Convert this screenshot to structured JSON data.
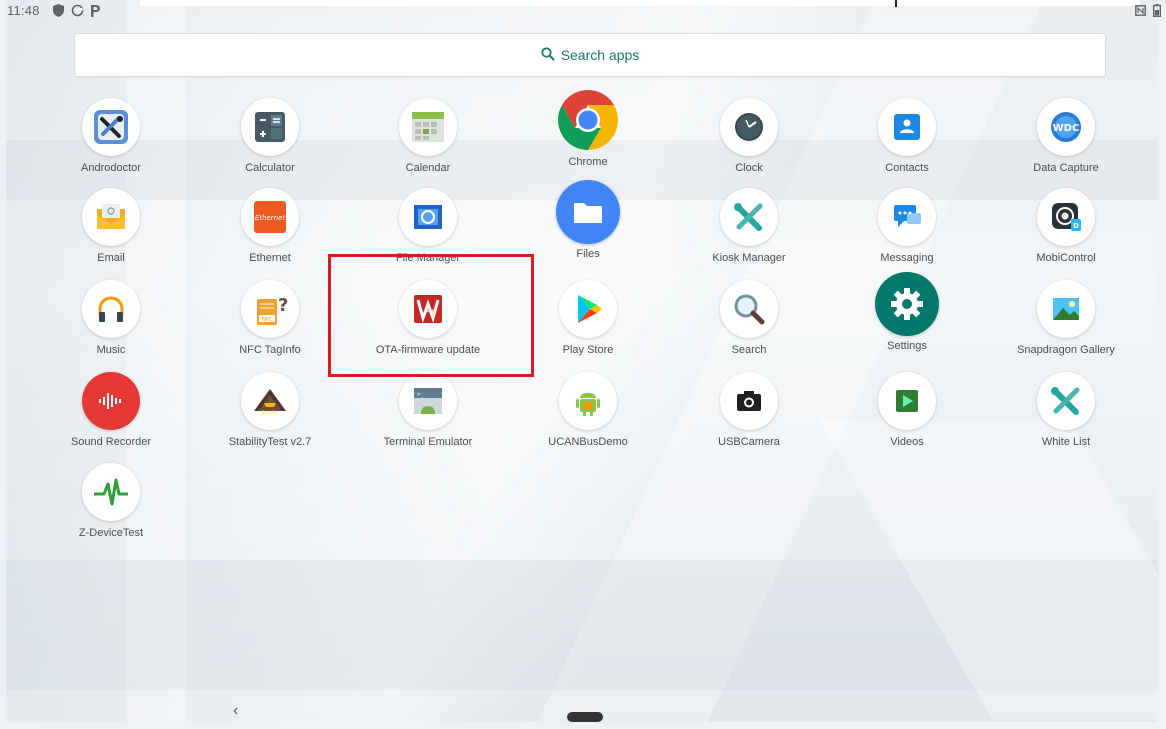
{
  "status": {
    "time": "11:48"
  },
  "search": {
    "label": "Search apps"
  },
  "apps": [
    {
      "label": "Androdoctor",
      "icon": "wrench-screwdriver-icon"
    },
    {
      "label": "Calculator",
      "icon": "calculator-icon"
    },
    {
      "label": "Calendar",
      "icon": "calendar-icon"
    },
    {
      "label": "Chrome",
      "icon": "chrome-icon"
    },
    {
      "label": "Clock",
      "icon": "clock-icon"
    },
    {
      "label": "Contacts",
      "icon": "contacts-icon"
    },
    {
      "label": "Data Capture",
      "icon": "wdc-icon"
    },
    {
      "label": "Email",
      "icon": "email-icon"
    },
    {
      "label": "Ethernet",
      "icon": "ethernet-icon"
    },
    {
      "label": "File Manager",
      "icon": "file-manager-icon"
    },
    {
      "label": "Files",
      "icon": "folder-icon"
    },
    {
      "label": "Kiosk Manager",
      "icon": "kiosk-tools-icon"
    },
    {
      "label": "Messaging",
      "icon": "messaging-icon"
    },
    {
      "label": "MobiControl",
      "icon": "mobicontrol-icon"
    },
    {
      "label": "Music",
      "icon": "headphones-icon"
    },
    {
      "label": "NFC TagInfo",
      "icon": "nfc-taginfo-icon"
    },
    {
      "label": "OTA-firmware update",
      "icon": "ota-firmware-icon"
    },
    {
      "label": "Play Store",
      "icon": "play-store-icon"
    },
    {
      "label": "Search",
      "icon": "magnifier-icon"
    },
    {
      "label": "Settings",
      "icon": "gear-icon"
    },
    {
      "label": "Snapdragon Gallery",
      "icon": "gallery-icon"
    },
    {
      "label": "Sound Recorder",
      "icon": "sound-recorder-icon"
    },
    {
      "label": "StabilityTest v2.7",
      "icon": "stability-test-icon"
    },
    {
      "label": "Terminal Emulator",
      "icon": "terminal-android-icon"
    },
    {
      "label": "UCANBusDemo",
      "icon": "android-robot-icon"
    },
    {
      "label": "USBCamera",
      "icon": "camera-icon"
    },
    {
      "label": "Videos",
      "icon": "video-play-icon"
    },
    {
      "label": "White List",
      "icon": "tools-icon"
    },
    {
      "label": "Z-DeviceTest",
      "icon": "heartbeat-icon"
    }
  ],
  "nav": {
    "back": "‹"
  },
  "colors": {
    "accent": "#1a7a6e",
    "highlight": "#e0191f"
  }
}
